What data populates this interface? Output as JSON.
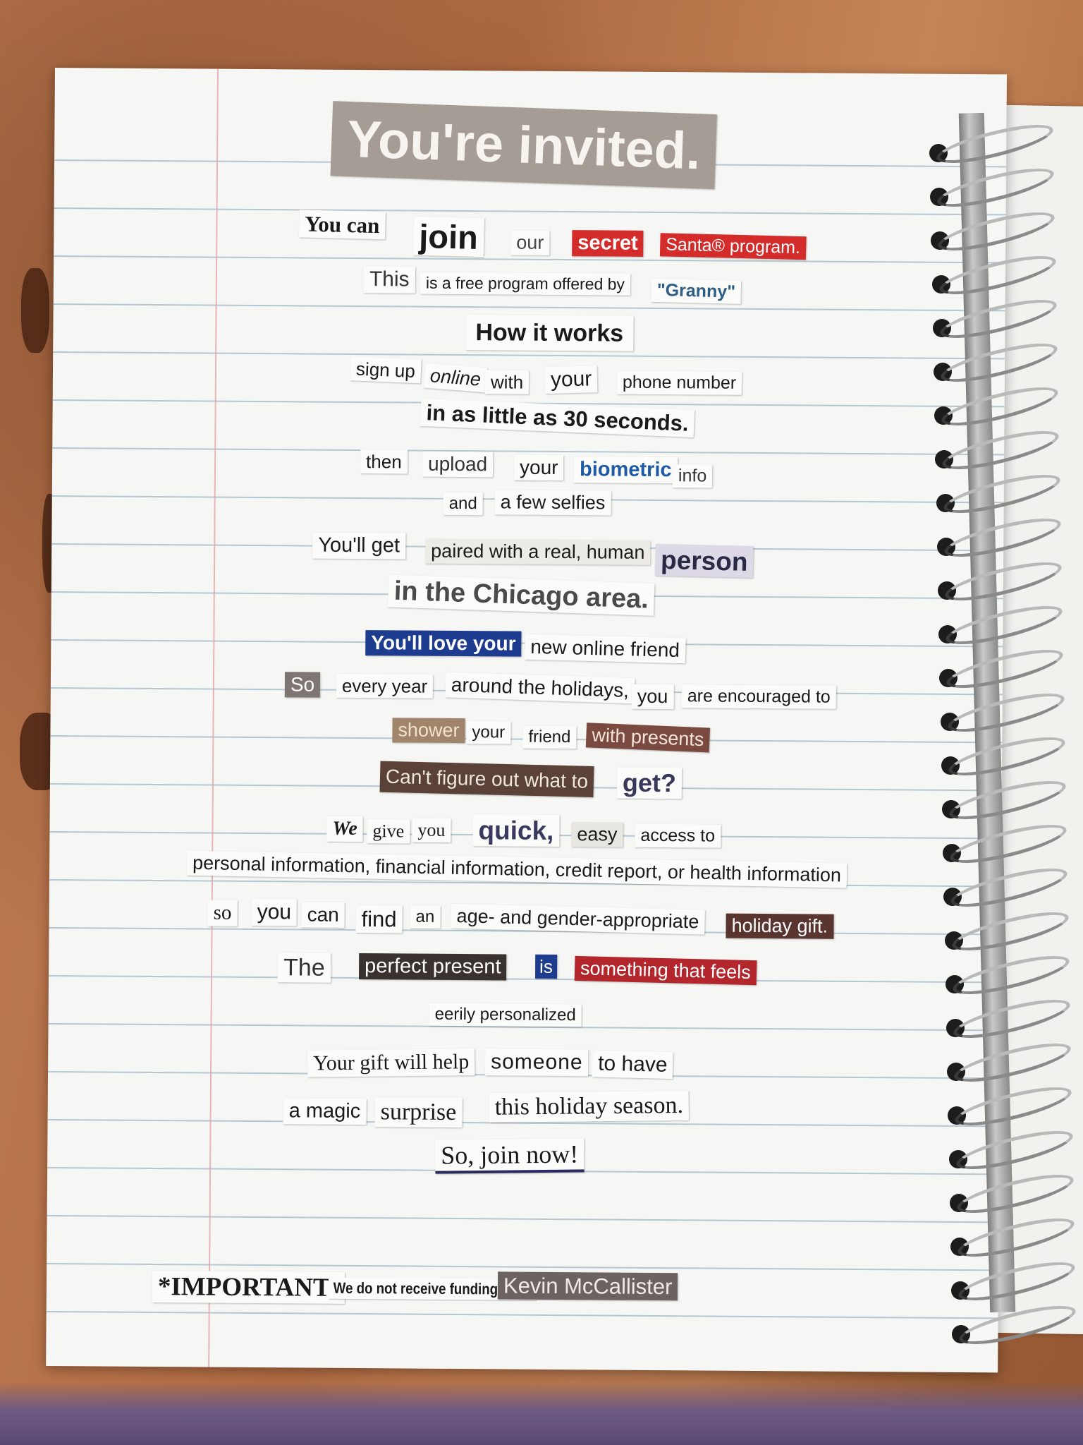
{
  "colors": {
    "desk": "#b9744a",
    "paper": "#f6f7f4",
    "rule": "#9fb7c9",
    "margin": "#e4a4a8",
    "title_bg": "#a59d95",
    "red": "#d42b2b",
    "navy": "#1e3c8f",
    "brown": "#5a4238",
    "dark_red": "#b2262c",
    "grey_label": "#7e7672"
  },
  "clips": [
    {
      "id": "title",
      "text": "You're invited."
    },
    {
      "id": "l1a",
      "text": "You can"
    },
    {
      "id": "l1b",
      "text": "join"
    },
    {
      "id": "l1c",
      "text": "our"
    },
    {
      "id": "l1d",
      "text": "secret"
    },
    {
      "id": "l1e",
      "text": "Santa® program."
    },
    {
      "id": "l2a",
      "text": "This"
    },
    {
      "id": "l2b",
      "text": "is a free program offered by"
    },
    {
      "id": "l2c",
      "text": "\"Granny\""
    },
    {
      "id": "l3",
      "text": "How it works"
    },
    {
      "id": "l4a",
      "text": "sign up"
    },
    {
      "id": "l4b",
      "text": "online"
    },
    {
      "id": "l4c",
      "text": "with"
    },
    {
      "id": "l4d",
      "text": "your"
    },
    {
      "id": "l4e",
      "text": "phone number"
    },
    {
      "id": "l5",
      "text": "in as little as 30 seconds."
    },
    {
      "id": "l6a",
      "text": "then"
    },
    {
      "id": "l6b",
      "text": "upload"
    },
    {
      "id": "l6c",
      "text": "your"
    },
    {
      "id": "l6d",
      "text": "biometric"
    },
    {
      "id": "l6e",
      "text": "info"
    },
    {
      "id": "l7a",
      "text": "and"
    },
    {
      "id": "l7b",
      "text": "a few selfies"
    },
    {
      "id": "l8a",
      "text": "You'll get"
    },
    {
      "id": "l8b",
      "text": "paired with a real, human"
    },
    {
      "id": "l8c",
      "text": "person"
    },
    {
      "id": "l9",
      "text": "in the Chicago area."
    },
    {
      "id": "l10a",
      "text": "You'll love your"
    },
    {
      "id": "l10b",
      "text": "new online friend"
    },
    {
      "id": "l11a",
      "text": "So"
    },
    {
      "id": "l11b",
      "text": "every year"
    },
    {
      "id": "l11c",
      "text": "around the holidays,"
    },
    {
      "id": "l11d",
      "text": "you"
    },
    {
      "id": "l11e",
      "text": "are encouraged to"
    },
    {
      "id": "l12a",
      "text": "shower"
    },
    {
      "id": "l12b",
      "text": "your"
    },
    {
      "id": "l12c",
      "text": "friend"
    },
    {
      "id": "l12d",
      "text": "with presents"
    },
    {
      "id": "l13a",
      "text": "Can't figure out what to"
    },
    {
      "id": "l13b",
      "text": "get?"
    },
    {
      "id": "l14a",
      "text": "We"
    },
    {
      "id": "l14b",
      "text": "give"
    },
    {
      "id": "l14c",
      "text": "you"
    },
    {
      "id": "l14d",
      "text": "quick,"
    },
    {
      "id": "l14e",
      "text": "easy"
    },
    {
      "id": "l14f",
      "text": "access to"
    },
    {
      "id": "l15",
      "text": "personal information, financial information, credit report, or health information"
    },
    {
      "id": "l16a",
      "text": "so"
    },
    {
      "id": "l16b",
      "text": "you"
    },
    {
      "id": "l16c",
      "text": "can"
    },
    {
      "id": "l16d",
      "text": "find"
    },
    {
      "id": "l16e",
      "text": "an"
    },
    {
      "id": "l16f",
      "text": "age- and gender-appropriate"
    },
    {
      "id": "l16g",
      "text": "holiday gift."
    },
    {
      "id": "l17a",
      "text": "The"
    },
    {
      "id": "l17b",
      "text": "perfect present"
    },
    {
      "id": "l17c",
      "text": "is"
    },
    {
      "id": "l17d",
      "text": "something that feels"
    },
    {
      "id": "l18",
      "text": "eerily personalized"
    },
    {
      "id": "l19a",
      "text": "Your gift will help"
    },
    {
      "id": "l19b",
      "text": "someone"
    },
    {
      "id": "l19c",
      "text": "to have"
    },
    {
      "id": "l20a",
      "text": "a magic"
    },
    {
      "id": "l20b",
      "text": "surprise"
    },
    {
      "id": "l20c",
      "text": "this holiday season."
    },
    {
      "id": "l21",
      "text": "So, join now!"
    },
    {
      "id": "f1",
      "text": "*IMPORTANT!"
    },
    {
      "id": "f2",
      "text": "We do not receive funding from"
    },
    {
      "id": "f3",
      "text": "Kevin McCallister"
    }
  ]
}
